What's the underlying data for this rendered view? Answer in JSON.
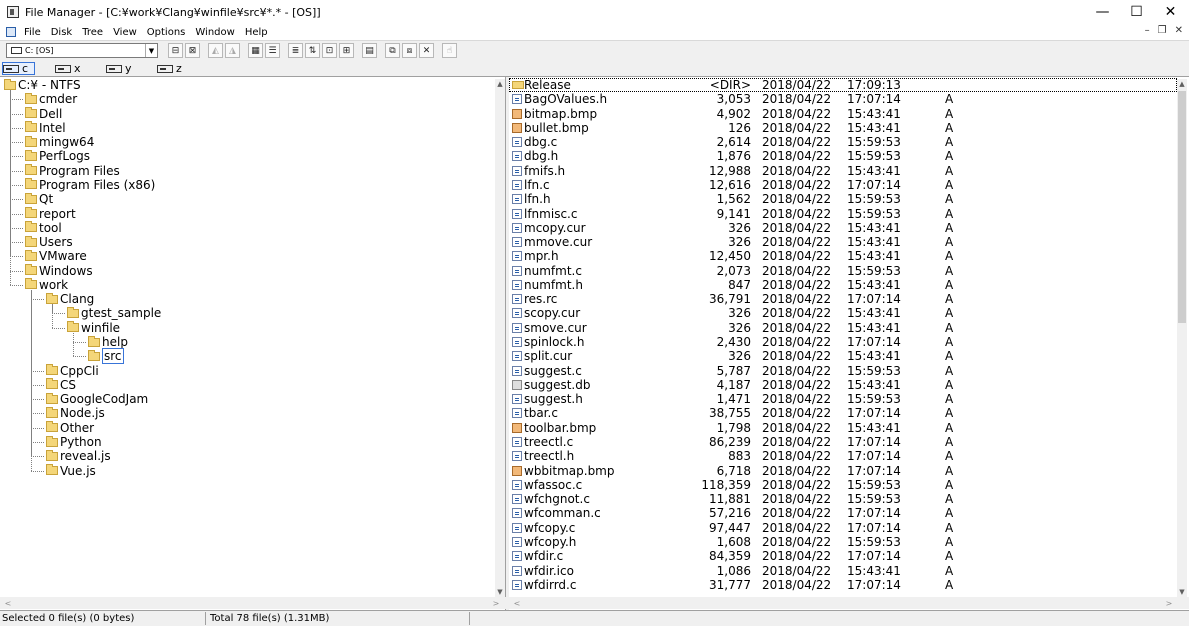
{
  "window": {
    "title": "File Manager - [C:¥work¥Clang¥winfile¥src¥*.* - [OS]]",
    "min": "—",
    "max": "☐",
    "close": "✕"
  },
  "menu": {
    "items": [
      "File",
      "Disk",
      "Tree",
      "View",
      "Options",
      "Window",
      "Help"
    ],
    "mdi_min": "–",
    "mdi_restore": "❐",
    "mdi_close": "✕"
  },
  "toolbar": {
    "drive_value": "C: [OS]",
    "dropdown_arrow": "▼"
  },
  "drives": [
    {
      "letter": "c",
      "active": true
    },
    {
      "letter": "x",
      "active": false
    },
    {
      "letter": "y",
      "active": false
    },
    {
      "letter": "z",
      "active": false
    }
  ],
  "tree": [
    {
      "label": "C:¥ - NTFS",
      "depth": 0,
      "selected": false
    },
    {
      "label": "cmder",
      "depth": 1,
      "selected": false
    },
    {
      "label": "Dell",
      "depth": 1,
      "selected": false
    },
    {
      "label": "Intel",
      "depth": 1,
      "selected": false
    },
    {
      "label": "mingw64",
      "depth": 1,
      "selected": false
    },
    {
      "label": "PerfLogs",
      "depth": 1,
      "selected": false
    },
    {
      "label": "Program Files",
      "depth": 1,
      "selected": false
    },
    {
      "label": "Program Files (x86)",
      "depth": 1,
      "selected": false
    },
    {
      "label": "Qt",
      "depth": 1,
      "selected": false
    },
    {
      "label": "report",
      "depth": 1,
      "selected": false
    },
    {
      "label": "tool",
      "depth": 1,
      "selected": false
    },
    {
      "label": "Users",
      "depth": 1,
      "selected": false
    },
    {
      "label": "VMware",
      "depth": 1,
      "selected": false
    },
    {
      "label": "Windows",
      "depth": 1,
      "selected": false
    },
    {
      "label": "work",
      "depth": 1,
      "selected": false
    },
    {
      "label": "Clang",
      "depth": 2,
      "selected": false
    },
    {
      "label": "gtest_sample",
      "depth": 3,
      "selected": false
    },
    {
      "label": "winfile",
      "depth": 3,
      "selected": false
    },
    {
      "label": "help",
      "depth": 4,
      "selected": false
    },
    {
      "label": "src",
      "depth": 4,
      "selected": true
    },
    {
      "label": "CppCli",
      "depth": 2,
      "selected": false
    },
    {
      "label": "CS",
      "depth": 2,
      "selected": false
    },
    {
      "label": "GoogleCodJam",
      "depth": 2,
      "selected": false
    },
    {
      "label": "Node.js",
      "depth": 2,
      "selected": false
    },
    {
      "label": "Other",
      "depth": 2,
      "selected": false
    },
    {
      "label": "Python",
      "depth": 2,
      "selected": false
    },
    {
      "label": "reveal.js",
      "depth": 2,
      "selected": false
    },
    {
      "label": "Vue.js",
      "depth": 2,
      "selected": false
    }
  ],
  "files": [
    {
      "name": "Release",
      "size": "<DIR>",
      "date": "2018/04/22",
      "time": "17:09:13",
      "attr": "",
      "icon": "dir"
    },
    {
      "name": "BagOValues.h",
      "size": "3,053",
      "date": "2018/04/22",
      "time": "17:07:14",
      "attr": "A",
      "icon": "doc"
    },
    {
      "name": "bitmap.bmp",
      "size": "4,902",
      "date": "2018/04/22",
      "time": "15:43:41",
      "attr": "A",
      "icon": "img"
    },
    {
      "name": "bullet.bmp",
      "size": "126",
      "date": "2018/04/22",
      "time": "15:43:41",
      "attr": "A",
      "icon": "img"
    },
    {
      "name": "dbg.c",
      "size": "2,614",
      "date": "2018/04/22",
      "time": "15:59:53",
      "attr": "A",
      "icon": "doc"
    },
    {
      "name": "dbg.h",
      "size": "1,876",
      "date": "2018/04/22",
      "time": "15:59:53",
      "attr": "A",
      "icon": "doc"
    },
    {
      "name": "fmifs.h",
      "size": "12,988",
      "date": "2018/04/22",
      "time": "15:43:41",
      "attr": "A",
      "icon": "doc"
    },
    {
      "name": "lfn.c",
      "size": "12,616",
      "date": "2018/04/22",
      "time": "17:07:14",
      "attr": "A",
      "icon": "doc"
    },
    {
      "name": "lfn.h",
      "size": "1,562",
      "date": "2018/04/22",
      "time": "15:59:53",
      "attr": "A",
      "icon": "doc"
    },
    {
      "name": "lfnmisc.c",
      "size": "9,141",
      "date": "2018/04/22",
      "time": "15:59:53",
      "attr": "A",
      "icon": "doc"
    },
    {
      "name": "mcopy.cur",
      "size": "326",
      "date": "2018/04/22",
      "time": "15:43:41",
      "attr": "A",
      "icon": "doc"
    },
    {
      "name": "mmove.cur",
      "size": "326",
      "date": "2018/04/22",
      "time": "15:43:41",
      "attr": "A",
      "icon": "doc"
    },
    {
      "name": "mpr.h",
      "size": "12,450",
      "date": "2018/04/22",
      "time": "15:43:41",
      "attr": "A",
      "icon": "doc"
    },
    {
      "name": "numfmt.c",
      "size": "2,073",
      "date": "2018/04/22",
      "time": "15:59:53",
      "attr": "A",
      "icon": "doc"
    },
    {
      "name": "numfmt.h",
      "size": "847",
      "date": "2018/04/22",
      "time": "15:43:41",
      "attr": "A",
      "icon": "doc"
    },
    {
      "name": "res.rc",
      "size": "36,791",
      "date": "2018/04/22",
      "time": "17:07:14",
      "attr": "A",
      "icon": "doc"
    },
    {
      "name": "scopy.cur",
      "size": "326",
      "date": "2018/04/22",
      "time": "15:43:41",
      "attr": "A",
      "icon": "doc"
    },
    {
      "name": "smove.cur",
      "size": "326",
      "date": "2018/04/22",
      "time": "15:43:41",
      "attr": "A",
      "icon": "doc"
    },
    {
      "name": "spinlock.h",
      "size": "2,430",
      "date": "2018/04/22",
      "time": "17:07:14",
      "attr": "A",
      "icon": "doc"
    },
    {
      "name": "split.cur",
      "size": "326",
      "date": "2018/04/22",
      "time": "15:43:41",
      "attr": "A",
      "icon": "doc"
    },
    {
      "name": "suggest.c",
      "size": "5,787",
      "date": "2018/04/22",
      "time": "15:59:53",
      "attr": "A",
      "icon": "doc"
    },
    {
      "name": "suggest.db",
      "size": "4,187",
      "date": "2018/04/22",
      "time": "15:43:41",
      "attr": "A",
      "icon": "sys"
    },
    {
      "name": "suggest.h",
      "size": "1,471",
      "date": "2018/04/22",
      "time": "15:59:53",
      "attr": "A",
      "icon": "doc"
    },
    {
      "name": "tbar.c",
      "size": "38,755",
      "date": "2018/04/22",
      "time": "17:07:14",
      "attr": "A",
      "icon": "doc"
    },
    {
      "name": "toolbar.bmp",
      "size": "1,798",
      "date": "2018/04/22",
      "time": "15:43:41",
      "attr": "A",
      "icon": "img"
    },
    {
      "name": "treectl.c",
      "size": "86,239",
      "date": "2018/04/22",
      "time": "17:07:14",
      "attr": "A",
      "icon": "doc"
    },
    {
      "name": "treectl.h",
      "size": "883",
      "date": "2018/04/22",
      "time": "17:07:14",
      "attr": "A",
      "icon": "doc"
    },
    {
      "name": "wbbitmap.bmp",
      "size": "6,718",
      "date": "2018/04/22",
      "time": "17:07:14",
      "attr": "A",
      "icon": "img"
    },
    {
      "name": "wfassoc.c",
      "size": "118,359",
      "date": "2018/04/22",
      "time": "15:59:53",
      "attr": "A",
      "icon": "doc"
    },
    {
      "name": "wfchgnot.c",
      "size": "11,881",
      "date": "2018/04/22",
      "time": "15:59:53",
      "attr": "A",
      "icon": "doc"
    },
    {
      "name": "wfcomman.c",
      "size": "57,216",
      "date": "2018/04/22",
      "time": "17:07:14",
      "attr": "A",
      "icon": "doc"
    },
    {
      "name": "wfcopy.c",
      "size": "97,447",
      "date": "2018/04/22",
      "time": "17:07:14",
      "attr": "A",
      "icon": "doc"
    },
    {
      "name": "wfcopy.h",
      "size": "1,608",
      "date": "2018/04/22",
      "time": "15:59:53",
      "attr": "A",
      "icon": "doc"
    },
    {
      "name": "wfdir.c",
      "size": "84,359",
      "date": "2018/04/22",
      "time": "17:07:14",
      "attr": "A",
      "icon": "doc"
    },
    {
      "name": "wfdir.ico",
      "size": "1,086",
      "date": "2018/04/22",
      "time": "15:43:41",
      "attr": "A",
      "icon": "doc"
    },
    {
      "name": "wfdirrd.c",
      "size": "31,777",
      "date": "2018/04/22",
      "time": "17:07:14",
      "attr": "A",
      "icon": "doc"
    }
  ],
  "status": {
    "selected": "Selected 0 file(s) (0 bytes)",
    "total": "Total 78 file(s) (1.31MB)"
  }
}
